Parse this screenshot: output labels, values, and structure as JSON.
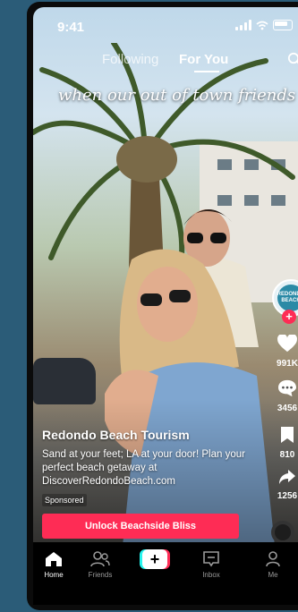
{
  "status_bar": {
    "time": "9:41"
  },
  "top_tabs": {
    "following": "Following",
    "for_you": "For You"
  },
  "video": {
    "caption_overlay": "when our out of town friends"
  },
  "creator": {
    "avatar_text": "REDONDO BEACH"
  },
  "actions": {
    "likes": "991K",
    "comments": "3456",
    "saves": "810",
    "shares": "1256"
  },
  "ad": {
    "brand": "Redondo Beach Tourism",
    "description": "Sand at your feet; LA at your door! Plan your perfect beach getaway at DiscoverRedondoBeach.com",
    "sponsored_label": "Sponsored",
    "cta_label": "Unlock Beachside Bliss"
  },
  "bottom_nav": {
    "home": "Home",
    "friends": "Friends",
    "inbox": "Inbox",
    "me": "Me"
  },
  "colors": {
    "background": "#2b5c78",
    "accent": "#fe2c55",
    "cyan": "#25f4ee"
  }
}
